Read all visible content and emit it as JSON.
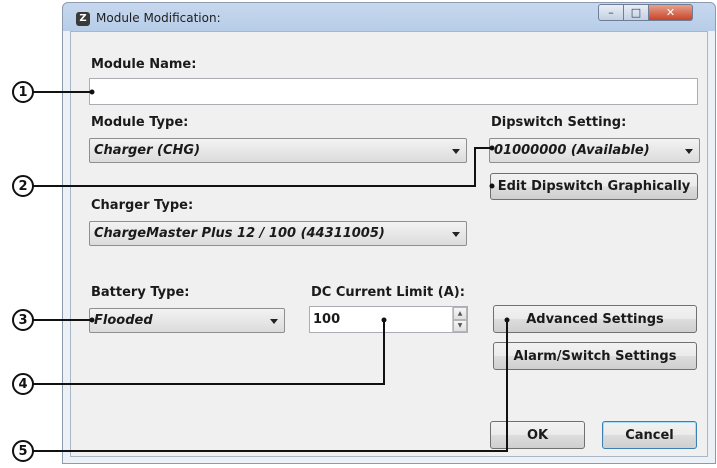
{
  "window": {
    "title": "Module Modification:",
    "app_icon": "app-logo-icon",
    "controls": {
      "minimize": "minimize-icon",
      "maximize": "maximize-icon",
      "close": "close-icon"
    }
  },
  "form": {
    "module_name": {
      "label": "Module Name:",
      "value": ""
    },
    "module_type": {
      "label": "Module Type:",
      "value": "Charger (CHG)"
    },
    "dipswitch": {
      "label": "Dipswitch Setting:",
      "value": "01000000 (Available)",
      "edit_button": "Edit Dipswitch Graphically"
    },
    "charger_type": {
      "label": "Charger Type:",
      "value": "ChargeMaster Plus 12 / 100 (44311005)"
    },
    "battery_type": {
      "label": "Battery Type:",
      "value": "Flooded"
    },
    "dc_current_limit": {
      "label": "DC Current Limit (A):",
      "value": "100"
    },
    "buttons": {
      "advanced": "Advanced Settings",
      "alarm_switch": "Alarm/Switch Settings",
      "ok": "OK",
      "cancel": "Cancel"
    }
  },
  "callouts": [
    "1",
    "2",
    "3",
    "4",
    "5"
  ],
  "colors": {
    "titlebar": "#b7cde8",
    "client": "#f0f0f0",
    "close_button": "#c7452a",
    "default_button_border": "#3c7fb1"
  }
}
